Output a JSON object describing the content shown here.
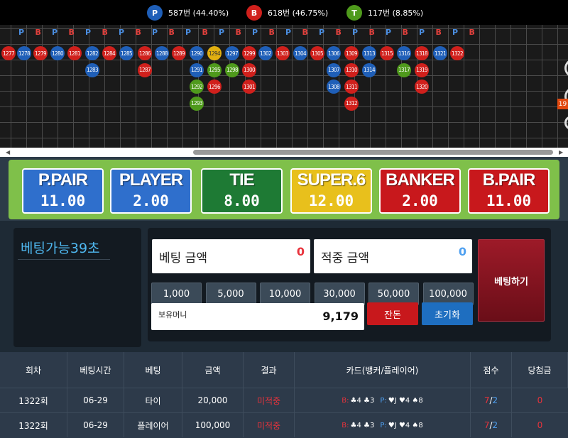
{
  "stats": [
    {
      "letter": "P",
      "text": "587번 (44.40%)",
      "color": "#1f5fb8"
    },
    {
      "letter": "B",
      "text": "618번 (46.75%)",
      "color": "#d0201c"
    },
    {
      "letter": "T",
      "text": "117번 (8.85%)",
      "color": "#4f9a1c"
    }
  ],
  "road": {
    "header": [
      "P",
      "B",
      "P",
      "B",
      "P",
      "B",
      "P",
      "B",
      "P",
      "B",
      "P",
      "B",
      "P",
      "B",
      "P",
      "B",
      "P",
      "B",
      "P",
      "B",
      "P",
      "B",
      "P",
      "B",
      "P",
      "B",
      "P",
      "B"
    ],
    "columns": [
      [
        {
          "n": "1277",
          "t": "B"
        }
      ],
      [
        {
          "n": "1278",
          "t": "P"
        }
      ],
      [
        {
          "n": "1279",
          "t": "B"
        }
      ],
      [
        {
          "n": "1280",
          "t": "P"
        }
      ],
      [
        {
          "n": "1281",
          "t": "B"
        }
      ],
      [
        {
          "n": "1282",
          "t": "P"
        },
        {
          "n": "1283",
          "t": "P"
        }
      ],
      [
        {
          "n": "1284",
          "t": "B"
        }
      ],
      [
        {
          "n": "1285",
          "t": "P"
        }
      ],
      [
        {
          "n": "1286",
          "t": "B"
        },
        {
          "n": "1287",
          "t": "B"
        }
      ],
      [
        {
          "n": "1288",
          "t": "P"
        }
      ],
      [
        {
          "n": "1289",
          "t": "B"
        }
      ],
      [
        {
          "n": "1290",
          "t": "P"
        },
        {
          "n": "1291",
          "t": "P"
        },
        {
          "n": "1292",
          "t": "T"
        },
        {
          "n": "1293",
          "t": "T"
        }
      ],
      [
        {
          "n": "1294",
          "t": "hl"
        },
        {
          "n": "1295",
          "t": "T"
        },
        {
          "n": "1296",
          "t": "B"
        }
      ],
      [
        {
          "n": "1297",
          "t": "P"
        },
        {
          "n": "1298",
          "t": "T"
        }
      ],
      [
        {
          "n": "1299",
          "t": "B"
        },
        {
          "n": "1300",
          "t": "B"
        },
        {
          "n": "1301",
          "t": "B"
        }
      ],
      [
        {
          "n": "1302",
          "t": "P"
        }
      ],
      [
        {
          "n": "1303",
          "t": "B"
        }
      ],
      [
        {
          "n": "1304",
          "t": "P"
        }
      ],
      [
        {
          "n": "1305",
          "t": "B"
        }
      ],
      [
        {
          "n": "1306",
          "t": "P"
        },
        {
          "n": "1307",
          "t": "P"
        },
        {
          "n": "1308",
          "t": "P"
        }
      ],
      [
        {
          "n": "1309",
          "t": "B"
        },
        {
          "n": "1310",
          "t": "B"
        },
        {
          "n": "1311",
          "t": "B"
        },
        {
          "n": "1312",
          "t": "B"
        }
      ],
      [
        {
          "n": "1313",
          "t": "P"
        },
        {
          "n": "1314",
          "t": "P"
        }
      ],
      [
        {
          "n": "1315",
          "t": "B"
        }
      ],
      [
        {
          "n": "1316",
          "t": "P"
        },
        {
          "n": "1317",
          "t": "T"
        }
      ],
      [
        {
          "n": "1318",
          "t": "B"
        },
        {
          "n": "1319",
          "t": "B"
        },
        {
          "n": "1320",
          "t": "B"
        }
      ],
      [
        {
          "n": "1321",
          "t": "P"
        }
      ],
      [
        {
          "n": "1322",
          "t": "B"
        }
      ]
    ],
    "edge_badge": "19"
  },
  "odds": [
    {
      "name": "P.PAIR",
      "value": "11.00",
      "bg": "#2f6fcc"
    },
    {
      "name": "PLAYER",
      "value": "2.00",
      "bg": "#2f6fcc"
    },
    {
      "name": "TIE",
      "value": "8.00",
      "bg": "#1e7a34"
    },
    {
      "name": "SUPER.6",
      "value": "12.00",
      "bg": "#e8c01c"
    },
    {
      "name": "BANKER",
      "value": "2.00",
      "bg": "#c8181c"
    },
    {
      "name": "B.PAIR",
      "value": "11.00",
      "bg": "#c8181c"
    }
  ],
  "control": {
    "timer": "베팅가능39초",
    "bet_label": "베팅 금액",
    "bet_value": "0",
    "win_label": "적중 금액",
    "win_value": "0",
    "chips": [
      "1,000",
      "5,000",
      "10,000",
      "30,000",
      "50,000",
      "100,000"
    ],
    "money_label": "보유머니",
    "money_value": "9,179",
    "change_btn": "잔돈",
    "reset_btn": "초기화",
    "bet_btn": "베팅하기"
  },
  "table": {
    "headers": [
      "회차",
      "베팅시간",
      "베팅",
      "금액",
      "결과",
      "카드(뱅커/플레이어)",
      "점수",
      "당첨금"
    ],
    "rows": [
      {
        "round": "1322회",
        "time": "06-29",
        "bet": "타이",
        "amount": "20,000",
        "result": "미적중",
        "card_b_label": "B:",
        "card_b": "♣4 ♣3",
        "card_p_label": "P:",
        "card_p": "♥J ♥4 ♠8",
        "score_b": "7",
        "score_p": "2",
        "prize": "0"
      },
      {
        "round": "1322회",
        "time": "06-29",
        "bet": "플레이어",
        "amount": "100,000",
        "result": "미적중",
        "card_b_label": "B:",
        "card_b": "♣4 ♣3",
        "card_p_label": "P:",
        "card_p": "♥J ♥4 ♠8",
        "score_b": "7",
        "score_p": "2",
        "prize": "0"
      }
    ]
  }
}
